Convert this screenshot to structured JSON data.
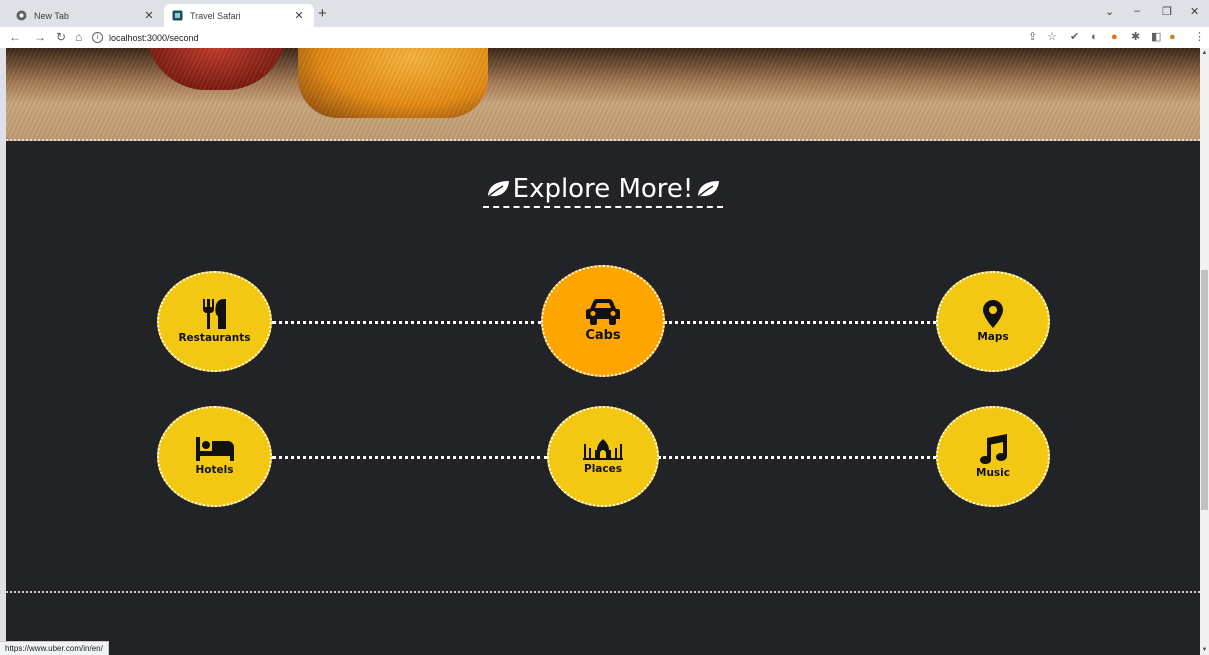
{
  "browser": {
    "tabs": [
      {
        "title": "New Tab",
        "icon": "chrome-icon"
      },
      {
        "title": "Travel Safari",
        "icon": "site-favicon"
      }
    ],
    "new_tab_label": "+",
    "address": "localhost:3000/second",
    "status_url": "https://www.uber.com/in/en/"
  },
  "page": {
    "title": "Explore More!",
    "services": [
      {
        "label": "Restaurants",
        "icon": "utensils-icon"
      },
      {
        "label": "Cabs",
        "icon": "car-icon",
        "active": true
      },
      {
        "label": "Maps",
        "icon": "map-pin-icon"
      },
      {
        "label": "Hotels",
        "icon": "bed-icon"
      },
      {
        "label": "Places",
        "icon": "monument-icon"
      },
      {
        "label": "Music",
        "icon": "music-note-icon"
      }
    ]
  },
  "colors": {
    "background": "#212326",
    "circle": "#f3c812",
    "circle_active": "#ffa500",
    "text_light": "#ffffff"
  }
}
